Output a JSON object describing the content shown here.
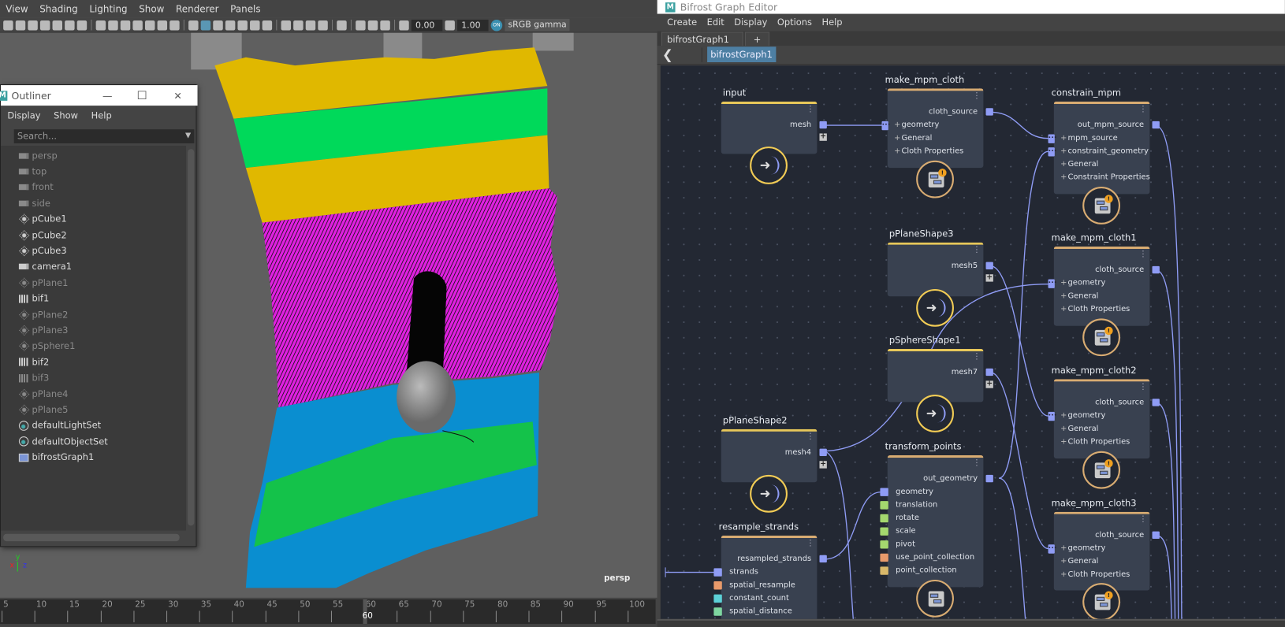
{
  "viewport": {
    "menu": [
      "View",
      "Shading",
      "Lighting",
      "Show",
      "Renderer",
      "Panels"
    ],
    "toolbar_icons": [
      "select-camera-icon",
      "lock-camera-icon",
      "camera-attributes-icon",
      "bookmark-icon",
      "image-plane-icon",
      "2d-pan-zoom-icon",
      "grease-pencil-icon",
      "sep",
      "grid-icon",
      "film-gate-icon",
      "resolution-gate-icon",
      "gate-mask-icon",
      "field-chart-icon",
      "safe-action-icon",
      "safe-title-icon",
      "sep",
      "wireframe-icon",
      "smooth-shade-all-icon",
      "default-material-icon",
      "wireframe-on-shaded-icon",
      "textured-icon",
      "use-all-lights-icon",
      "shadows-icon",
      "sep",
      "screen-space-ao-icon",
      "motion-blur-icon",
      "multisample-aa-icon",
      "depth-of-field-icon",
      "sep",
      "isolate-select-icon",
      "sep",
      "xray-icon",
      "xray-joints-icon",
      "xray-active-icon",
      "sep",
      "exposure-icon"
    ],
    "toolbar": {
      "exposure": "0.00",
      "gamma": "1.00",
      "on_badge": "ON",
      "color_space": "sRGB gamma"
    },
    "camera_label": "persp",
    "axis": {
      "x": "x",
      "y": "y",
      "z": "z"
    }
  },
  "outliner": {
    "title": "Outliner",
    "logo": "M",
    "window_controls": {
      "minimize": "—",
      "maximize": "☐",
      "close": "✕"
    },
    "menu": [
      "Display",
      "Show",
      "Help"
    ],
    "search_placeholder": "Search...",
    "items": [
      {
        "label": "persp",
        "icon": "camera-icon",
        "dim": true
      },
      {
        "label": "top",
        "icon": "camera-icon",
        "dim": true
      },
      {
        "label": "front",
        "icon": "camera-icon",
        "dim": true
      },
      {
        "label": "side",
        "icon": "camera-icon",
        "dim": true
      },
      {
        "label": "pCube1",
        "icon": "transform-icon",
        "dim": false
      },
      {
        "label": "pCube2",
        "icon": "transform-icon",
        "dim": false
      },
      {
        "label": "pCube3",
        "icon": "transform-icon",
        "dim": false
      },
      {
        "label": "camera1",
        "icon": "camera-icon",
        "dim": false
      },
      {
        "label": "pPlane1",
        "icon": "transform-icon",
        "dim": true
      },
      {
        "label": "bif1",
        "icon": "bifrost-icon",
        "dim": false
      },
      {
        "label": "pPlane2",
        "icon": "transform-icon",
        "dim": true
      },
      {
        "label": "pPlane3",
        "icon": "transform-icon",
        "dim": true
      },
      {
        "label": "pSphere1",
        "icon": "transform-icon",
        "dim": true
      },
      {
        "label": "bif2",
        "icon": "bifrost-icon",
        "dim": false
      },
      {
        "label": "bif3",
        "icon": "bifrost-icon",
        "dim": true
      },
      {
        "label": "pPlane4",
        "icon": "transform-icon",
        "dim": true
      },
      {
        "label": "pPlane5",
        "icon": "transform-icon",
        "dim": true
      },
      {
        "label": "defaultLightSet",
        "icon": "set-icon",
        "dim": false
      },
      {
        "label": "defaultObjectSet",
        "icon": "set-icon",
        "dim": false
      },
      {
        "label": "bifrostGraph1",
        "icon": "bifrost-graph-icon",
        "dim": false
      }
    ]
  },
  "timeline": {
    "ticks": [
      "5",
      "10",
      "15",
      "20",
      "25",
      "30",
      "35",
      "40",
      "45",
      "50",
      "55",
      "60",
      "65",
      "70",
      "75",
      "80",
      "85",
      "90",
      "95",
      "100"
    ],
    "current_frame": "60"
  },
  "editor": {
    "title": "Bifrost Graph Editor",
    "logo": "M",
    "menu": [
      "Create",
      "Edit",
      "Display",
      "Options",
      "Help"
    ],
    "tab": {
      "label": "bifrostGraph1",
      "close": "✕"
    },
    "add_tab": "+",
    "back": "❮",
    "breadcrumb": "bifrostGraph1",
    "nodes": [
      {
        "title": "input",
        "type": "input",
        "outputs": [
          "mesh"
        ],
        "inputs": []
      },
      {
        "title": "make_mpm_cloth",
        "type": "compound",
        "outputs": [
          "cloth_source"
        ],
        "inputs": [
          {
            "label": "geometry",
            "port": "connector",
            "expand": true
          },
          {
            "label": "General",
            "expand": true
          },
          {
            "label": "Cloth Properties",
            "expand": true
          }
        ]
      },
      {
        "title": "constrain_mpm",
        "type": "compound",
        "outputs": [
          "out_mpm_source"
        ],
        "inputs": [
          {
            "label": "mpm_source",
            "port": "connector",
            "expand": true
          },
          {
            "label": "constraint_geometry",
            "port": "connector",
            "expand": true
          },
          {
            "label": "General",
            "expand": true
          },
          {
            "label": "Constraint Properties",
            "expand": true
          }
        ]
      },
      {
        "title": "pPlaneShape3",
        "type": "input",
        "outputs": [
          "mesh5"
        ],
        "inputs": []
      },
      {
        "title": "make_mpm_cloth1",
        "type": "compound",
        "outputs": [
          "cloth_source"
        ],
        "inputs": [
          {
            "label": "geometry",
            "port": "connector",
            "expand": true
          },
          {
            "label": "General",
            "expand": true
          },
          {
            "label": "Cloth Properties",
            "expand": true
          }
        ]
      },
      {
        "title": "pSphereShape1",
        "type": "input",
        "outputs": [
          "mesh7"
        ],
        "inputs": []
      },
      {
        "title": "make_mpm_cloth2",
        "type": "compound",
        "outputs": [
          "cloth_source"
        ],
        "inputs": [
          {
            "label": "geometry",
            "port": "connector",
            "expand": true
          },
          {
            "label": "General",
            "expand": true
          },
          {
            "label": "Cloth Properties",
            "expand": true
          }
        ]
      },
      {
        "title": "pPlaneShape2",
        "type": "input",
        "outputs": [
          "mesh4"
        ],
        "inputs": []
      },
      {
        "title": "transform_points",
        "type": "compound-plain",
        "outputs": [
          "out_geometry"
        ],
        "inputs": [
          {
            "label": "geometry",
            "port": "#8f9cf5"
          },
          {
            "label": "translation",
            "port": "#a4d86e"
          },
          {
            "label": "rotate",
            "port": "#a4d86e"
          },
          {
            "label": "scale",
            "port": "#a4d86e"
          },
          {
            "label": "pivot",
            "port": "#a4d86e"
          },
          {
            "label": "use_point_collection",
            "port": "#e89a6b"
          },
          {
            "label": "point_collection",
            "port": "#d9b86a"
          }
        ]
      },
      {
        "title": "make_mpm_cloth3",
        "type": "compound",
        "outputs": [
          "cloth_source"
        ],
        "inputs": [
          {
            "label": "geometry",
            "port": "connector",
            "expand": true
          },
          {
            "label": "General",
            "expand": true
          },
          {
            "label": "Cloth Properties",
            "expand": true
          }
        ]
      },
      {
        "title": "resample_strands",
        "type": "compound-noicon",
        "outputs": [
          "resampled_strands"
        ],
        "inputs": [
          {
            "label": "strands",
            "port": "#8f9cf5"
          },
          {
            "label": "spatial_resample",
            "port": "#e89a6b"
          },
          {
            "label": "constant_count",
            "port": "#5cd0d6"
          },
          {
            "label": "spatial_distance",
            "port": "#7ed6a0"
          }
        ]
      }
    ],
    "badge_glyph": "!"
  },
  "colors": {
    "wire": "#8f9cf5",
    "input_node_accent": "#f2cc55",
    "compound_node_accent": "#d9ac72",
    "graph_bg": "#232833",
    "node_bg": "#394150"
  }
}
